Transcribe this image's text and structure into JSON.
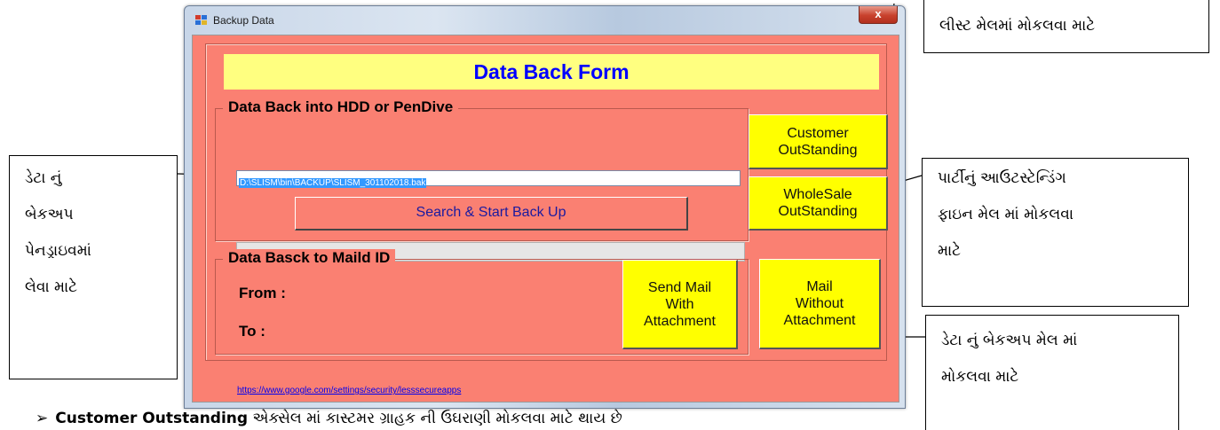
{
  "window": {
    "title": "Backup Data",
    "close_glyph": "x"
  },
  "form": {
    "header": "Data Back Form",
    "hdd_group": {
      "legend": "Data Back into HDD or PenDive",
      "path_value": "D:\\SLISM\\bin\\BACKUP\\SLISM_301102018.bak",
      "search_button": "Search & Start Back Up",
      "progress": 0
    },
    "mail_group": {
      "legend": "Data Basck to Maild ID",
      "from_label": "From :",
      "to_label": "To :"
    },
    "buttons": {
      "customer_outstanding": [
        "Customer",
        "OutStanding"
      ],
      "wholesale_outstanding": [
        "WholeSale",
        "OutStanding"
      ],
      "send_mail_with_attachment": [
        "Send Mail",
        "With",
        "Attachment"
      ],
      "mail_without_attachment": [
        "Mail",
        "Without",
        "Attachment"
      ]
    },
    "footer_link": "https://www.google.com/settings/security/lesssecureapps"
  },
  "callouts": {
    "top_right": [
      "લીસ્ટ મેલમાં મોકલવા માટે"
    ],
    "left": [
      "ડેટા નું",
      "બેકઅપ",
      "પેનડ્રાઇવમાં",
      "લેવા માટે"
    ],
    "right_middle": [
      "પાર્ટીનું આઉટસ્ટેન્ડિંગ",
      "ફાઇન મેલ માં મોકલવા",
      "માટે"
    ],
    "right_bottom": [
      "ડેટા નું બેકઅપ મેલ માં",
      "મોકલવા માટે"
    ]
  },
  "bottom_note": {
    "bullet": "➢",
    "bold": "Customer Outstanding",
    "text": " એક્સેલ માં કાસ્ટમર ગ્રાહક ની ઉઘરાણી મોકલવા માટે થાય છે"
  },
  "colors": {
    "form_bg": "#fa8072",
    "header_bg": "#ffff80",
    "header_text": "#0000ff",
    "button_bg": "#ffff00"
  },
  "icons": [
    "app-icon",
    "close-icon",
    "bullet-arrow-icon"
  ]
}
